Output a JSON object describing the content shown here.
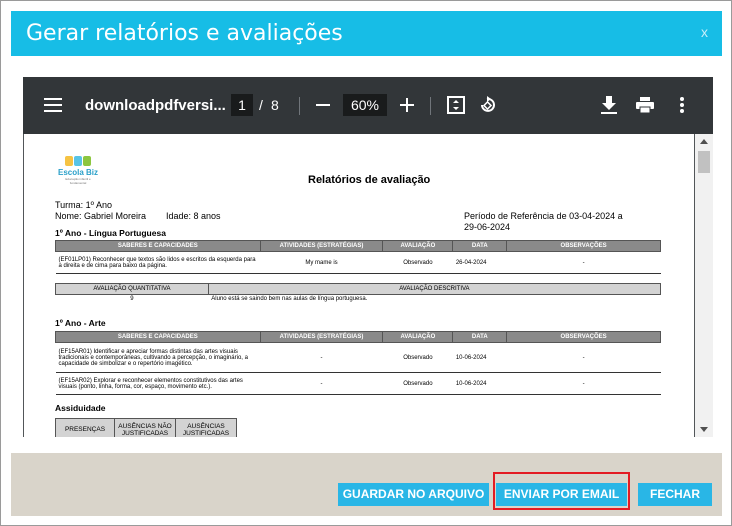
{
  "modal": {
    "title": "Gerar relatórios e avaliações",
    "close_label": "x"
  },
  "viewer": {
    "filename": "downloadpdfversi...",
    "current_page": "1",
    "page_separator": "/",
    "total_pages": "8",
    "zoom": "60%",
    "toolbar_bg": "#323639"
  },
  "document": {
    "logo_name": "Escola Biz",
    "logo_tagline": "Educação infantil e fundamental",
    "title": "Relatórios de avaliação",
    "turma": "Turma: 1º Ano",
    "nome": "Nome: Gabriel Moreira",
    "idade": "Idade: 8 anos",
    "periodo_line1": "Período de Referência de 03-04-2024 a",
    "periodo_line2": "29-06-2024",
    "columns": {
      "saberes": "SABERES E CAPACIDADES",
      "atividades": "ATIVIDADES (ESTRATÉGIAS)",
      "avaliacao": "AVALIAÇÃO",
      "data": "DATA",
      "observacoes": "OBSERVAÇÕES"
    },
    "sections": [
      {
        "title": "1º Ano - Língua Portuguesa",
        "rows": [
          {
            "saberes": "(EF01LP01) Reconhecer que textos são lidos e escritos da esquerda para a direita e de cima para baixo da página.",
            "atividades": "My mame is",
            "avaliacao": "Observado",
            "data": "26-04-2024",
            "observacoes": "-"
          }
        ],
        "quant_header": "AVALIAÇÃO QUANTITATIVA",
        "desc_header": "AVALIAÇÃO DESCRITIVA",
        "quant_value": "9",
        "desc_value": "Aluno está se saindo bem nas aulas de língua portuguesa."
      },
      {
        "title": "1º Ano - Arte",
        "rows": [
          {
            "saberes": "(EF15AR01) Identificar e apreciar formas distintas das artes visuais tradicionais e contemporâneas, cultivando a percepção, o imaginário, a capacidade de simbolizar e o repertório imagético.",
            "atividades": "-",
            "avaliacao": "Observado",
            "data": "10-06-2024",
            "observacoes": "-"
          },
          {
            "saberes": "(EF15AR02) Explorar e reconhecer elementos constitutivos das artes visuais (ponto, linha, forma, cor, espaço, movimento etc.).",
            "atividades": "-",
            "avaliacao": "Observado",
            "data": "10-06-2024",
            "observacoes": "-"
          }
        ]
      }
    ],
    "assiduidade": {
      "title": "Assiduidade",
      "presencas": "PRESENÇAS",
      "ausencias_nao_line1": "AUSÊNCIAS NÃO",
      "ausencias_nao_line2": "JUSTIFICADAS",
      "ausencias_line1": "AUSÊNCIAS",
      "ausencias_line2": "JUSTIFICADAS"
    }
  },
  "footer": {
    "guardar_label": "GUARDAR NO ARQUIVO",
    "enviar_label": "ENVIAR POR EMAIL",
    "fechar_label": "FECHAR"
  },
  "colors": {
    "header_accent": "#17bde6",
    "button": "#29b6e6",
    "highlight": "#e31b23",
    "footer_bg": "#d9d4ca"
  }
}
